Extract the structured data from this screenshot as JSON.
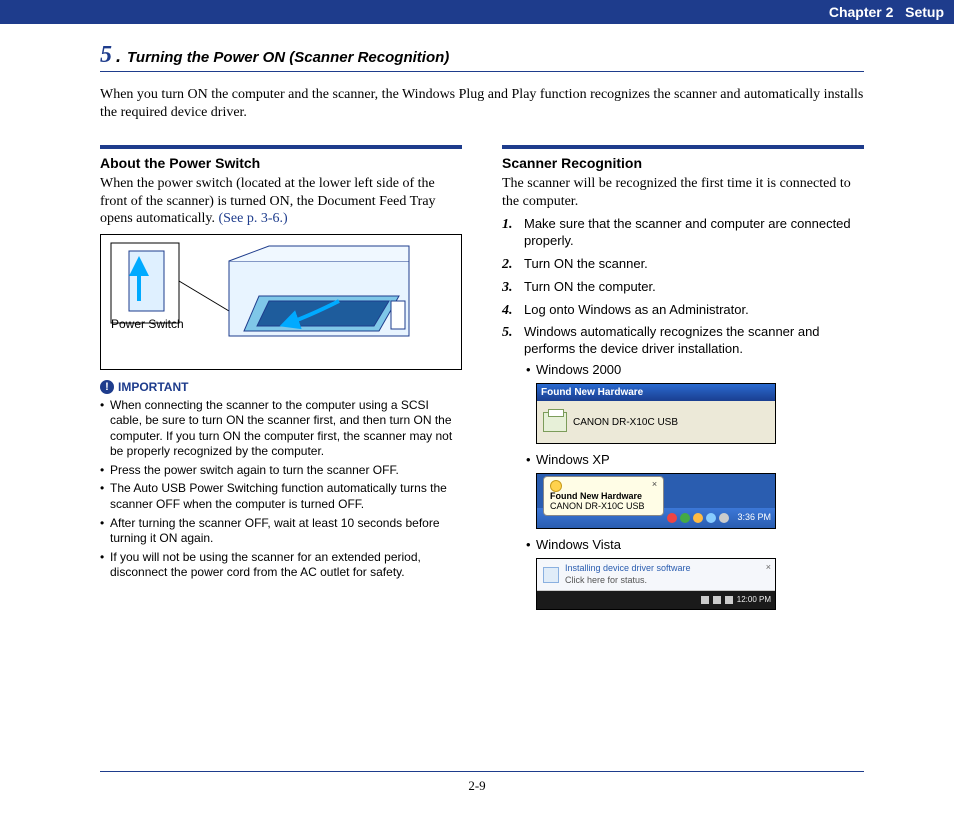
{
  "header": {
    "chapter": "Chapter 2",
    "title": "Setup"
  },
  "section": {
    "number": "5",
    "title": "Turning the Power ON (Scanner Recognition)",
    "intro": "When you turn ON the computer and the scanner, the Windows Plug and Play function recognizes the scanner and automatically installs the required device driver."
  },
  "left": {
    "heading": "About the Power Switch",
    "para": "When the power switch (located at the lower left side of the front of the scanner) is turned ON, the Document Feed Tray opens automatically.",
    "see_ref": " (See p. 3-6.)",
    "figure_caption": "Power Switch",
    "important_label": "IMPORTANT",
    "bullets": [
      "When connecting the scanner to the computer using a SCSI cable, be sure to turn ON the scanner first, and then turn ON the computer. If you turn ON the computer first, the scanner may not be properly recognized by the computer.",
      "Press the power switch again to turn the scanner OFF.",
      "The Auto USB Power Switching function automatically turns the scanner OFF when the computer is turned OFF.",
      "After turning the scanner OFF, wait at least 10 seconds before turning it ON again.",
      "If you will not be using the scanner for an extended period, disconnect the power cord from the AC outlet for safety."
    ]
  },
  "right": {
    "heading": "Scanner Recognition",
    "para": "The scanner will be recognized the first time it is connected to the computer.",
    "steps": [
      "Make sure that the scanner and computer are connected properly.",
      "Turn ON the scanner.",
      "Turn ON the computer.",
      "Log onto Windows as an Administrator.",
      "Windows automatically recognizes the scanner and performs the device driver installation."
    ],
    "os_items": [
      {
        "label": "Windows 2000",
        "dialog_title": "Found New Hardware",
        "dialog_body": "CANON   DR-X10C USB"
      },
      {
        "label": "Windows XP",
        "balloon_title": "Found New Hardware",
        "balloon_body": "CANON DR-X10C USB",
        "clock": "3:36 PM"
      },
      {
        "label": "Windows Vista",
        "balloon_title": "Installing device driver software",
        "balloon_body": "Click here for status.",
        "clock": "12:00 PM"
      }
    ]
  },
  "footer": {
    "page_num": "2-9"
  }
}
